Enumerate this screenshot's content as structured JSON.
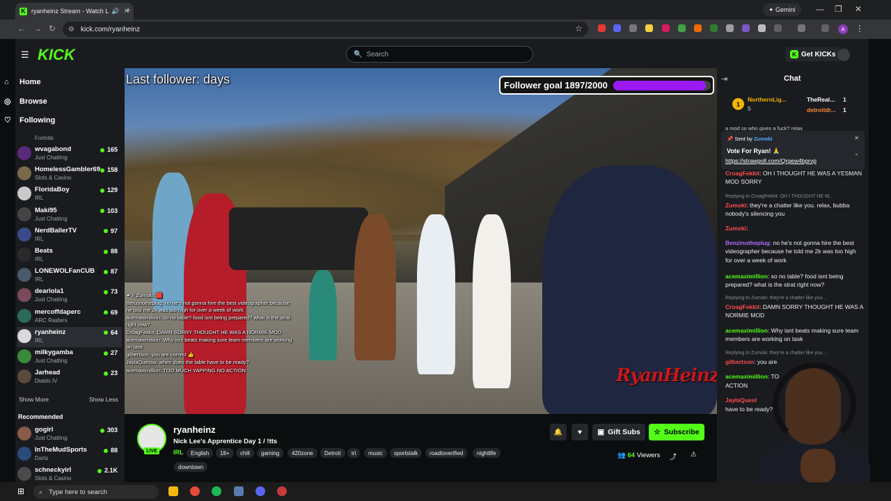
{
  "browser": {
    "tab_title": "ryanheinz Stream - Watch L",
    "favicon": "K",
    "gemini": "Gemini",
    "url": "kick.com/ryanheinz"
  },
  "kick": {
    "logo": "KICK",
    "search_placeholder": "Search",
    "get_kicks": "Get KICKs",
    "accent": "#53fc18"
  },
  "sidebar": {
    "nav": [
      {
        "label": "Home",
        "icon": "home-icon"
      },
      {
        "label": "Browse",
        "icon": "compass-icon"
      },
      {
        "label": "Following",
        "icon": "heart-icon"
      }
    ],
    "following_partial": "Fortnite",
    "following": [
      {
        "name": "wvagabond",
        "category": "Just Chatting",
        "viewers": "165",
        "color": "#5a2a7a"
      },
      {
        "name": "HomelessGambler69",
        "category": "Slots & Casino",
        "viewers": "158",
        "color": "#7a6a4a"
      },
      {
        "name": "FloridaBoy",
        "category": "IRL",
        "viewers": "129",
        "color": "#c9c9c9"
      },
      {
        "name": "Maki95",
        "category": "Just Chatting",
        "viewers": "103",
        "color": "#444"
      },
      {
        "name": "NerdBallerTV",
        "category": "IRL",
        "viewers": "97",
        "color": "#3a4a8a"
      },
      {
        "name": "Beats",
        "category": "IRL",
        "viewers": "88",
        "color": "#2a2a2a"
      },
      {
        "name": "LONEWOLFanCUB",
        "category": "IRL",
        "viewers": "87",
        "color": "#4a5a6a"
      },
      {
        "name": "dearlola1",
        "category": "Just Chatting",
        "viewers": "73",
        "color": "#7a4a5a"
      },
      {
        "name": "mercoffdaperc",
        "category": "ARC Raiders",
        "viewers": "69",
        "color": "#2a6a5a"
      },
      {
        "name": "ryanheinz",
        "category": "IRL",
        "viewers": "64",
        "color": "#d9d9d9"
      },
      {
        "name": "milkygamba",
        "category": "Just Chatting",
        "viewers": "27",
        "color": "#3a8a3a"
      },
      {
        "name": "Jarhead",
        "category": "Diablo IV",
        "viewers": "23",
        "color": "#5a4a3a"
      }
    ],
    "show_more": "Show More",
    "show_less": "Show Less",
    "recommended_title": "Recommended",
    "recommended": [
      {
        "name": "gogirl",
        "category": "Just Chatting",
        "viewers": "303",
        "color": "#8a5a4a"
      },
      {
        "name": "InTheMudSports",
        "category": "Darts",
        "viewers": "88",
        "color": "#2a4a7a"
      },
      {
        "name": "schneckyirl",
        "category": "Slots & Casino",
        "viewers": "2.1K",
        "color": "#4a4a4a"
      }
    ]
  },
  "video": {
    "last_follower": "Last follower: days",
    "follower_goal": "Follower goal 1897/2000",
    "goal_fraction": 0.9485,
    "watermark": "RyanHeinz",
    "overlay_chat": [
      "✦ // Zumoki: 🟥",
      "Benzinotheplug: no he's not gonna hire the best videographer because he told me 2k was too high for over a week of work",
      "acemaximillion: so no table? food isnt being prepared? what is the strat right now?",
      "CroagFekkit: DAMN SORRY THOUGHT HE WAS A NORMIE MOD",
      "acemaximillion: Why isnt beats making sure team members are working on task",
      "gilbertson: you are correct 👍",
      "JaylaQuestia: when does the table have to be ready?",
      "acemaximillion: TOO MUCH YAPPING NO ACTION"
    ]
  },
  "stream": {
    "name": "ryanheinz",
    "title": "Nick Lee's Apprentice Day 1 / !tts",
    "category": "IRL",
    "live": "LIVE",
    "tags": [
      "English",
      "18+",
      "chill",
      "gaming",
      "420zone",
      "Detroit",
      "irl",
      "music",
      "sportstalk",
      "roadtoverified",
      "nightlife",
      "downtown"
    ],
    "gift_subs": "Gift Subs",
    "subscribe": "Subscribe",
    "viewers": "64",
    "viewers_label": "Viewers"
  },
  "chat": {
    "title": "Chat",
    "leaders": [
      {
        "rank": "1",
        "name": "NorthernLig...",
        "count": "5"
      },
      {
        "name": "TheReal...",
        "count": "1"
      },
      {
        "name": "detroitdr...",
        "count": "1"
      }
    ],
    "cut_line": "a mod so who gives a fuck? relax",
    "pinned": {
      "sent_by": "Sent by",
      "sender": "Zumoki",
      "text": "Vote For Ryan! 🙏",
      "link": "https://strawpoll.com/Qrgew4bprvp"
    },
    "messages": [
      {
        "user": "CroagFekkit",
        "color": "#ff4d4d",
        "text": ": OH I THOUGHT HE WAS A YESMAN MOD SORRY"
      },
      {
        "reply": "Replying to CroagFekkit: OH I THOUGHT HE W..."
      },
      {
        "user": "Zumoki",
        "color": "#ff4d4d",
        "text": ": they're a chatter like you. relax, bubba nobody's silencing you"
      },
      {
        "user": "Zumoki",
        "color": "#ff4d4d",
        "text": ":"
      },
      {
        "user": "Benzinotheplug",
        "color": "#b06cff",
        "text": ": no he's not gonna hire the best videographer because he told me 2k was too high for over a week of work"
      },
      {
        "user": "acemaximillion",
        "color": "#53fc18",
        "text": ": so no table? food isnt being prepared? what is the strat right now?"
      },
      {
        "reply": "Replying to Zumoki: they're a chatter like you..."
      },
      {
        "user": "CroagFekkit",
        "color": "#ff4d4d",
        "text": ": DAMN SORRY THOUGHT HE WAS A NORMIE MOD"
      },
      {
        "user": "acemaximillion",
        "color": "#53fc18",
        "text": ": Why isnt beats making sure team members are working on task"
      },
      {
        "reply": "Replying to Zumoki: they're a chatter like you..."
      },
      {
        "user": "gilbertson",
        "color": "#ff4d4d",
        "text": ": you are"
      },
      {
        "user": "acemaximillion",
        "color": "#53fc18",
        "text": ": TO"
      },
      {
        "user": "",
        "color": "#efeff1",
        "text": "ACTION"
      },
      {
        "user": "JaylaQuest",
        "color": "#ff4d4d",
        "text": ""
      },
      {
        "user": "",
        "color": "#efeff1",
        "text": "have to be ready?"
      }
    ]
  },
  "taskbar": {
    "search_placeholder": "Type here to search"
  }
}
